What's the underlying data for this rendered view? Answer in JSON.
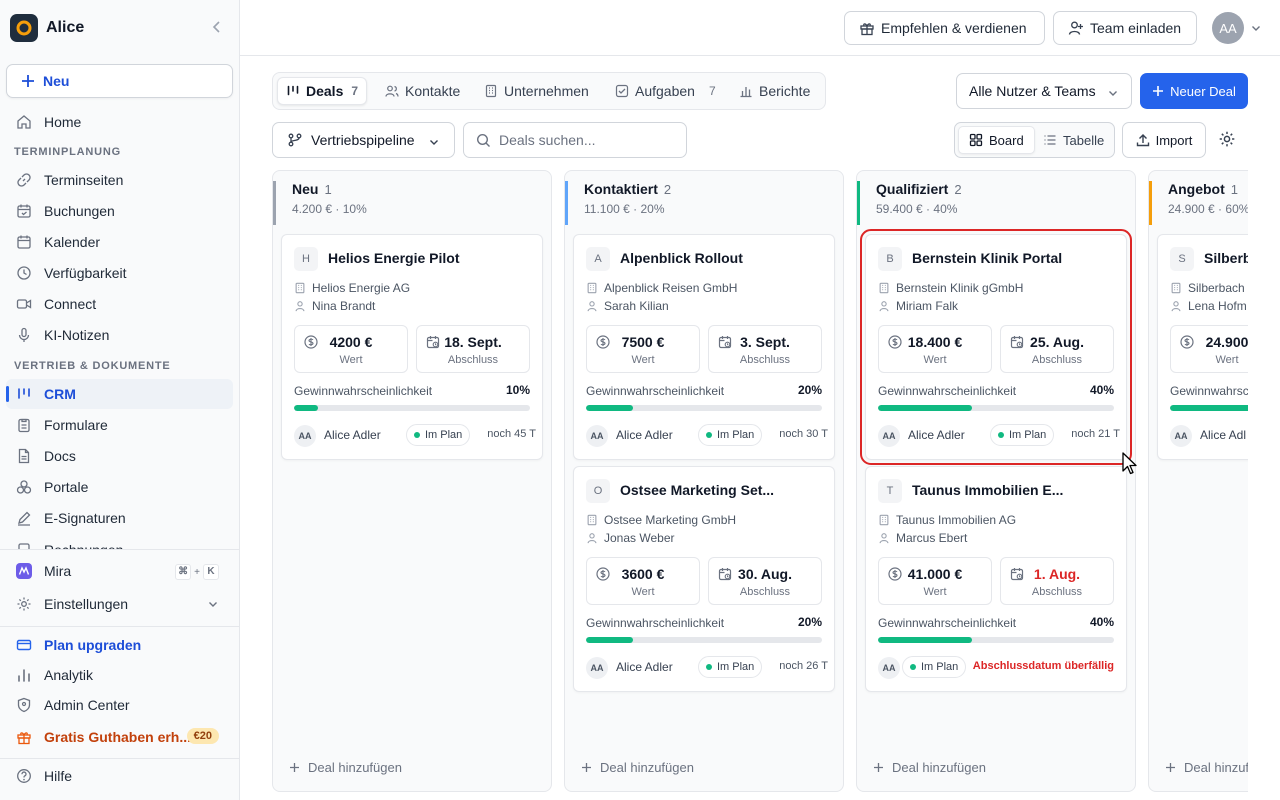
{
  "workspace": {
    "name": "Alice"
  },
  "sidebar": {
    "new_label": "Neu",
    "home": "Home",
    "section_scheduling": "TERMINPLANUNG",
    "scheduling": [
      "Terminseiten",
      "Buchungen",
      "Kalender",
      "Verfügbarkeit",
      "Connect",
      "KI-Notizen"
    ],
    "section_sales": "VERTRIEB & DOKUMENTE",
    "sales": [
      "CRM",
      "Formulare",
      "Docs",
      "Portale",
      "E-Signaturen",
      "Rechnungen"
    ],
    "mira": "Mira",
    "mira_shortcut": [
      "⌘",
      "+",
      "K"
    ],
    "settings": "Einstellungen",
    "upgrade": "Plan upgraden",
    "analytics": "Analytik",
    "admin": "Admin Center",
    "credit": "Gratis Guthaben erh...",
    "credit_badge": "€20",
    "help": "Hilfe"
  },
  "header": {
    "refer": "Empfehlen & verdienen",
    "invite": "Team einladen",
    "avatar": "AA"
  },
  "tabs": [
    {
      "label": "Deals",
      "count": "7"
    },
    {
      "label": "Kontakte",
      "count": ""
    },
    {
      "label": "Unternehmen",
      "count": ""
    },
    {
      "label": "Aufgaben",
      "count": "7"
    },
    {
      "label": "Berichte",
      "count": ""
    }
  ],
  "filters": {
    "users": "Alle Nutzer & Teams",
    "new_deal": "Neuer Deal",
    "pipeline": "Vertriebspipeline",
    "search_placeholder": "Deals suchen...",
    "board": "Board",
    "table": "Tabelle",
    "import": "Import"
  },
  "board": {
    "add_deal": "Deal hinzufügen",
    "value_label": "Wert",
    "close_label": "Abschluss",
    "prob_label": "Gewinnwahrscheinlichkeit",
    "columns": [
      {
        "title": "Neu",
        "count": "1",
        "sum": "4.200 €",
        "pct": "10%",
        "color": "#9ca3af"
      },
      {
        "title": "Kontaktiert",
        "count": "2",
        "sum": "11.100 €",
        "pct": "20%",
        "color": "#60a5fa"
      },
      {
        "title": "Qualifiziert",
        "count": "2",
        "sum": "59.400 €",
        "pct": "40%",
        "color": "#10b981"
      },
      {
        "title": "Angebot",
        "count": "1",
        "sum": "24.900 €",
        "pct": "60%",
        "color": "#f59e0b"
      }
    ],
    "cards": [
      {
        "initial": "H",
        "title": "Helios Energie Pilot",
        "company": "Helios Energie AG",
        "contact": "Nina Brandt",
        "value": "4200 €",
        "close": "18. Sept.",
        "prob": "10%",
        "progress": 0.1,
        "owner_initials": "AA",
        "owner": "Alice Adler",
        "status": "Im Plan",
        "remaining": "noch 45 T"
      },
      {
        "initial": "A",
        "title": "Alpenblick Rollout",
        "company": "Alpenblick Reisen GmbH",
        "contact": "Sarah Kilian",
        "value": "7500 €",
        "close": "3. Sept.",
        "prob": "20%",
        "progress": 0.2,
        "owner_initials": "AA",
        "owner": "Alice Adler",
        "status": "Im Plan",
        "remaining": "noch 30 T"
      },
      {
        "initial": "O",
        "title": "Ostsee Marketing Set...",
        "company": "Ostsee Marketing GmbH",
        "contact": "Jonas Weber",
        "value": "3600 €",
        "close": "30. Aug.",
        "prob": "20%",
        "progress": 0.2,
        "owner_initials": "AA",
        "owner": "Alice Adler",
        "status": "Im Plan",
        "remaining": "noch 26 T"
      },
      {
        "initial": "B",
        "title": "Bernstein Klinik Portal",
        "company": "Bernstein Klinik gGmbH",
        "contact": "Miriam Falk",
        "value": "18.400 €",
        "close": "25. Aug.",
        "prob": "40%",
        "progress": 0.4,
        "owner_initials": "AA",
        "owner": "Alice Adler",
        "status": "Im Plan",
        "remaining": "noch 21 T"
      },
      {
        "initial": "T",
        "title": "Taunus Immobilien E...",
        "company": "Taunus Immobilien AG",
        "contact": "Marcus Ebert",
        "value": "41.000 €",
        "close": "1. Aug.",
        "prob": "40%",
        "progress": 0.4,
        "owner_initials": "AA",
        "status": "Im Plan",
        "overdue": "Abschlussdatum überfällig"
      },
      {
        "initial": "S",
        "title": "Silberbach",
        "company": "Silberbach",
        "contact": "Lena Hofm",
        "value": "24.900",
        "prob_partial": "Gewinnwahrsc",
        "progress": 0.6,
        "owner_initials": "AA",
        "owner": "Alice Adl"
      }
    ]
  },
  "colors": {
    "accent": "#2563eb",
    "success": "#10b981",
    "danger": "#dc2626"
  }
}
